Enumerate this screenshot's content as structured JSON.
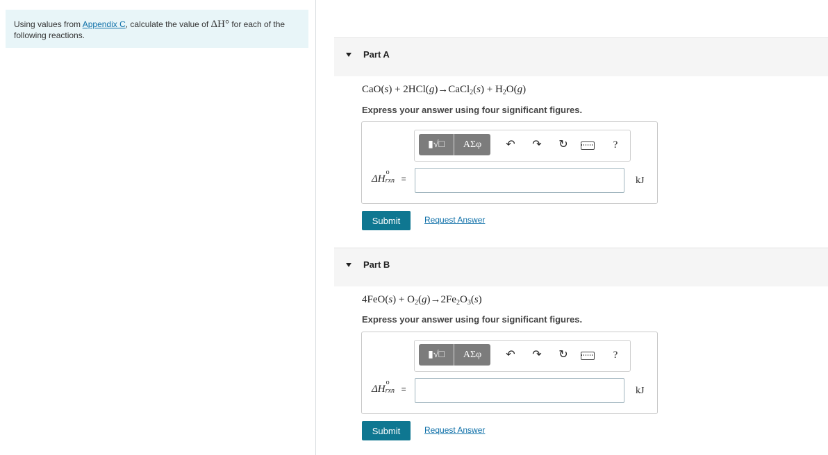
{
  "intro": {
    "text_before": "Using values from ",
    "link": "Appendix C",
    "text_middle": ", calculate the value of ",
    "symbol": "ΔH°",
    "text_after": " for each of the following reactions."
  },
  "parts": [
    {
      "title": "Part A",
      "equation": {
        "t1": "CaO(",
        "v1": "s",
        "t2": ") + 2HCl(",
        "v2": "g",
        "t3": ")→CaCl",
        "s1": "2",
        "t4": "(",
        "v3": "s",
        "t5": ") + H",
        "s2": "2",
        "t6": "O(",
        "v4": "g",
        "t7": ")"
      },
      "instruction": "Express your answer using four significant figures.",
      "toolbar": {
        "templates_label": "▮√□",
        "symbols_label": "ΑΣφ",
        "undo": "↶",
        "redo": "↷",
        "reset": "↻",
        "help": "?"
      },
      "label": {
        "delta": "ΔH",
        "sup": "o",
        "sub": "rxn",
        "equals": "="
      },
      "input_value": "",
      "unit": "kJ",
      "submit": "Submit",
      "request": "Request Answer"
    },
    {
      "title": "Part B",
      "equation": {
        "t1": "4FeO(",
        "v1": "s",
        "t2": ") + O",
        "s1": "2",
        "t3": "(",
        "v2": "g",
        "t4": ")→2Fe",
        "s2": "2",
        "t5": "O",
        "s3": "3",
        "t6": "(",
        "v3": "s",
        "t7": ")"
      },
      "instruction": "Express your answer using four significant figures.",
      "toolbar": {
        "templates_label": "▮√□",
        "symbols_label": "ΑΣφ",
        "undo": "↶",
        "redo": "↷",
        "reset": "↻",
        "help": "?"
      },
      "label": {
        "delta": "ΔH",
        "sup": "o",
        "sub": "rxn",
        "equals": "="
      },
      "input_value": "",
      "unit": "kJ",
      "submit": "Submit",
      "request": "Request Answer"
    }
  ]
}
